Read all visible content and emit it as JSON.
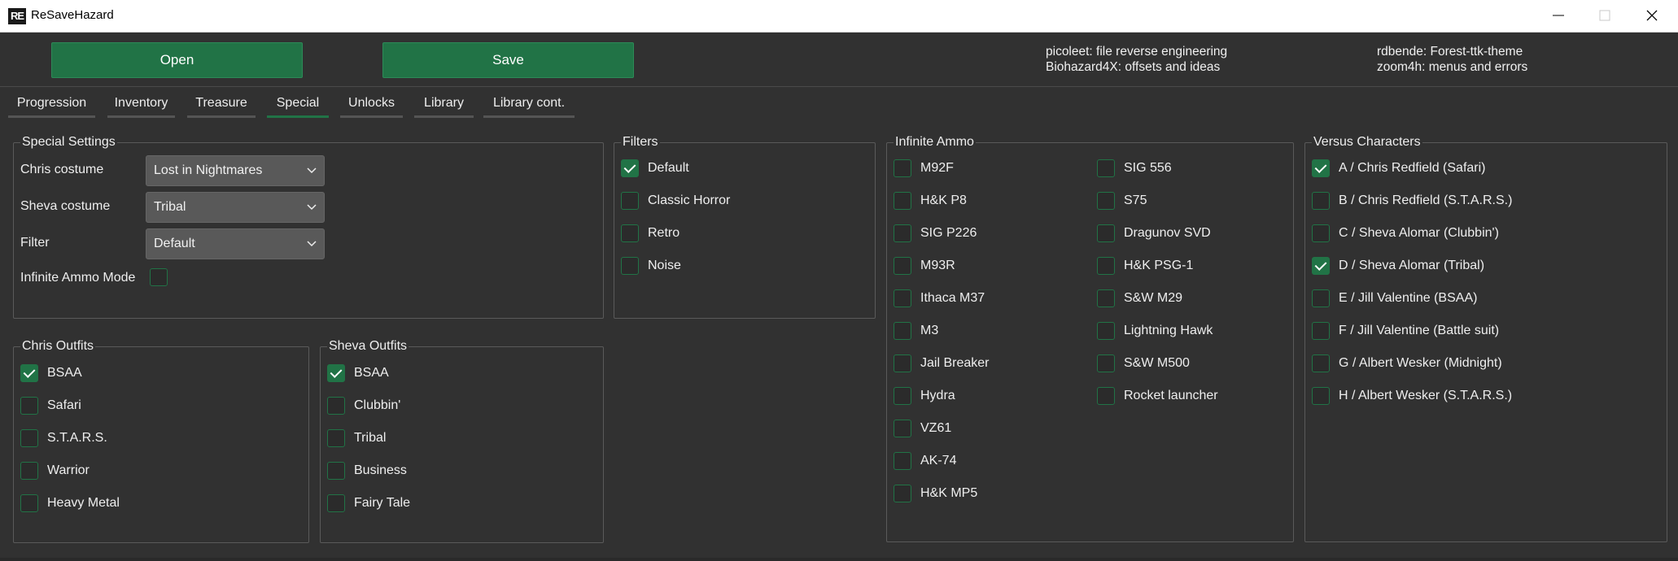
{
  "window": {
    "icon_text": "RE",
    "title": "ReSaveHazard"
  },
  "toolbar": {
    "open_label": "Open",
    "save_label": "Save"
  },
  "credits": {
    "col1": [
      "picoleet: file reverse engineering",
      "Biohazard4X: offsets and ideas"
    ],
    "col2": [
      "rdbende: Forest-ttk-theme",
      "zoom4h: menus and errors"
    ]
  },
  "tabs": [
    "Progression",
    "Inventory",
    "Treasure",
    "Special",
    "Unlocks",
    "Library",
    "Library cont."
  ],
  "active_tab": "Special",
  "accent_color": "#217346",
  "special_settings": {
    "title": "Special Settings",
    "chris_costume_label": "Chris costume",
    "chris_costume_value": "Lost in Nightmares",
    "sheva_costume_label": "Sheva costume",
    "sheva_costume_value": "Tribal",
    "filter_label": "Filter",
    "filter_value": "Default",
    "infinite_ammo_mode_label": "Infinite Ammo Mode",
    "infinite_ammo_mode_checked": false
  },
  "filters": {
    "title": "Filters",
    "items": [
      {
        "label": "Default",
        "checked": true
      },
      {
        "label": "Classic Horror",
        "checked": false
      },
      {
        "label": "Retro",
        "checked": false
      },
      {
        "label": "Noise",
        "checked": false
      }
    ]
  },
  "infinite_ammo": {
    "title": "Infinite Ammo",
    "col1": [
      {
        "label": "M92F",
        "checked": false
      },
      {
        "label": "H&K P8",
        "checked": false
      },
      {
        "label": "SIG P226",
        "checked": false
      },
      {
        "label": "M93R",
        "checked": false
      },
      {
        "label": "Ithaca M37",
        "checked": false
      },
      {
        "label": "M3",
        "checked": false
      },
      {
        "label": "Jail Breaker",
        "checked": false
      },
      {
        "label": "Hydra",
        "checked": false
      },
      {
        "label": "VZ61",
        "checked": false
      },
      {
        "label": "AK-74",
        "checked": false
      },
      {
        "label": "H&K MP5",
        "checked": false
      }
    ],
    "col2": [
      {
        "label": "SIG 556",
        "checked": false
      },
      {
        "label": "S75",
        "checked": false
      },
      {
        "label": "Dragunov SVD",
        "checked": false
      },
      {
        "label": "H&K PSG-1",
        "checked": false
      },
      {
        "label": "S&W M29",
        "checked": false
      },
      {
        "label": "Lightning Hawk",
        "checked": false
      },
      {
        "label": "S&W M500",
        "checked": false
      },
      {
        "label": "Rocket launcher",
        "checked": false
      }
    ]
  },
  "versus_characters": {
    "title": "Versus Characters",
    "items": [
      {
        "label": "A / Chris Redfield (Safari)",
        "checked": true
      },
      {
        "label": "B / Chris Redfield (S.T.A.R.S.)",
        "checked": false
      },
      {
        "label": "C / Sheva Alomar (Clubbin')",
        "checked": false
      },
      {
        "label": "D / Sheva Alomar (Tribal)",
        "checked": true
      },
      {
        "label": "E / Jill Valentine (BSAA)",
        "checked": false
      },
      {
        "label": "F / Jill Valentine (Battle suit)",
        "checked": false
      },
      {
        "label": "G / Albert Wesker (Midnight)",
        "checked": false
      },
      {
        "label": "H / Albert Wesker (S.T.A.R.S.)",
        "checked": false
      }
    ]
  },
  "chris_outfits": {
    "title": "Chris Outfits",
    "items": [
      {
        "label": "BSAA",
        "checked": true
      },
      {
        "label": "Safari",
        "checked": false
      },
      {
        "label": "S.T.A.R.S.",
        "checked": false
      },
      {
        "label": "Warrior",
        "checked": false
      },
      {
        "label": "Heavy Metal",
        "checked": false
      }
    ]
  },
  "sheva_outfits": {
    "title": "Sheva Outfits",
    "items": [
      {
        "label": "BSAA",
        "checked": true
      },
      {
        "label": "Clubbin'",
        "checked": false
      },
      {
        "label": "Tribal",
        "checked": false
      },
      {
        "label": "Business",
        "checked": false
      },
      {
        "label": "Fairy Tale",
        "checked": false
      }
    ]
  }
}
